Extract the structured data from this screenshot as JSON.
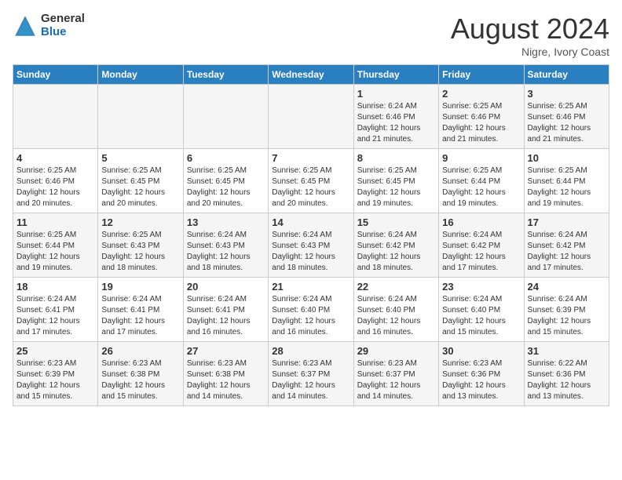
{
  "header": {
    "logo_general": "General",
    "logo_blue": "Blue",
    "month_title": "August 2024",
    "location": "Nigre, Ivory Coast"
  },
  "weekdays": [
    "Sunday",
    "Monday",
    "Tuesday",
    "Wednesday",
    "Thursday",
    "Friday",
    "Saturday"
  ],
  "weeks": [
    [
      {
        "day": "",
        "info": ""
      },
      {
        "day": "",
        "info": ""
      },
      {
        "day": "",
        "info": ""
      },
      {
        "day": "",
        "info": ""
      },
      {
        "day": "1",
        "info": "Sunrise: 6:24 AM\nSunset: 6:46 PM\nDaylight: 12 hours\nand 21 minutes."
      },
      {
        "day": "2",
        "info": "Sunrise: 6:25 AM\nSunset: 6:46 PM\nDaylight: 12 hours\nand 21 minutes."
      },
      {
        "day": "3",
        "info": "Sunrise: 6:25 AM\nSunset: 6:46 PM\nDaylight: 12 hours\nand 21 minutes."
      }
    ],
    [
      {
        "day": "4",
        "info": "Sunrise: 6:25 AM\nSunset: 6:46 PM\nDaylight: 12 hours\nand 20 minutes."
      },
      {
        "day": "5",
        "info": "Sunrise: 6:25 AM\nSunset: 6:45 PM\nDaylight: 12 hours\nand 20 minutes."
      },
      {
        "day": "6",
        "info": "Sunrise: 6:25 AM\nSunset: 6:45 PM\nDaylight: 12 hours\nand 20 minutes."
      },
      {
        "day": "7",
        "info": "Sunrise: 6:25 AM\nSunset: 6:45 PM\nDaylight: 12 hours\nand 20 minutes."
      },
      {
        "day": "8",
        "info": "Sunrise: 6:25 AM\nSunset: 6:45 PM\nDaylight: 12 hours\nand 19 minutes."
      },
      {
        "day": "9",
        "info": "Sunrise: 6:25 AM\nSunset: 6:44 PM\nDaylight: 12 hours\nand 19 minutes."
      },
      {
        "day": "10",
        "info": "Sunrise: 6:25 AM\nSunset: 6:44 PM\nDaylight: 12 hours\nand 19 minutes."
      }
    ],
    [
      {
        "day": "11",
        "info": "Sunrise: 6:25 AM\nSunset: 6:44 PM\nDaylight: 12 hours\nand 19 minutes."
      },
      {
        "day": "12",
        "info": "Sunrise: 6:25 AM\nSunset: 6:43 PM\nDaylight: 12 hours\nand 18 minutes."
      },
      {
        "day": "13",
        "info": "Sunrise: 6:24 AM\nSunset: 6:43 PM\nDaylight: 12 hours\nand 18 minutes."
      },
      {
        "day": "14",
        "info": "Sunrise: 6:24 AM\nSunset: 6:43 PM\nDaylight: 12 hours\nand 18 minutes."
      },
      {
        "day": "15",
        "info": "Sunrise: 6:24 AM\nSunset: 6:42 PM\nDaylight: 12 hours\nand 18 minutes."
      },
      {
        "day": "16",
        "info": "Sunrise: 6:24 AM\nSunset: 6:42 PM\nDaylight: 12 hours\nand 17 minutes."
      },
      {
        "day": "17",
        "info": "Sunrise: 6:24 AM\nSunset: 6:42 PM\nDaylight: 12 hours\nand 17 minutes."
      }
    ],
    [
      {
        "day": "18",
        "info": "Sunrise: 6:24 AM\nSunset: 6:41 PM\nDaylight: 12 hours\nand 17 minutes."
      },
      {
        "day": "19",
        "info": "Sunrise: 6:24 AM\nSunset: 6:41 PM\nDaylight: 12 hours\nand 17 minutes."
      },
      {
        "day": "20",
        "info": "Sunrise: 6:24 AM\nSunset: 6:41 PM\nDaylight: 12 hours\nand 16 minutes."
      },
      {
        "day": "21",
        "info": "Sunrise: 6:24 AM\nSunset: 6:40 PM\nDaylight: 12 hours\nand 16 minutes."
      },
      {
        "day": "22",
        "info": "Sunrise: 6:24 AM\nSunset: 6:40 PM\nDaylight: 12 hours\nand 16 minutes."
      },
      {
        "day": "23",
        "info": "Sunrise: 6:24 AM\nSunset: 6:40 PM\nDaylight: 12 hours\nand 15 minutes."
      },
      {
        "day": "24",
        "info": "Sunrise: 6:24 AM\nSunset: 6:39 PM\nDaylight: 12 hours\nand 15 minutes."
      }
    ],
    [
      {
        "day": "25",
        "info": "Sunrise: 6:23 AM\nSunset: 6:39 PM\nDaylight: 12 hours\nand 15 minutes."
      },
      {
        "day": "26",
        "info": "Sunrise: 6:23 AM\nSunset: 6:38 PM\nDaylight: 12 hours\nand 15 minutes."
      },
      {
        "day": "27",
        "info": "Sunrise: 6:23 AM\nSunset: 6:38 PM\nDaylight: 12 hours\nand 14 minutes."
      },
      {
        "day": "28",
        "info": "Sunrise: 6:23 AM\nSunset: 6:37 PM\nDaylight: 12 hours\nand 14 minutes."
      },
      {
        "day": "29",
        "info": "Sunrise: 6:23 AM\nSunset: 6:37 PM\nDaylight: 12 hours\nand 14 minutes."
      },
      {
        "day": "30",
        "info": "Sunrise: 6:23 AM\nSunset: 6:36 PM\nDaylight: 12 hours\nand 13 minutes."
      },
      {
        "day": "31",
        "info": "Sunrise: 6:22 AM\nSunset: 6:36 PM\nDaylight: 12 hours\nand 13 minutes."
      }
    ]
  ]
}
